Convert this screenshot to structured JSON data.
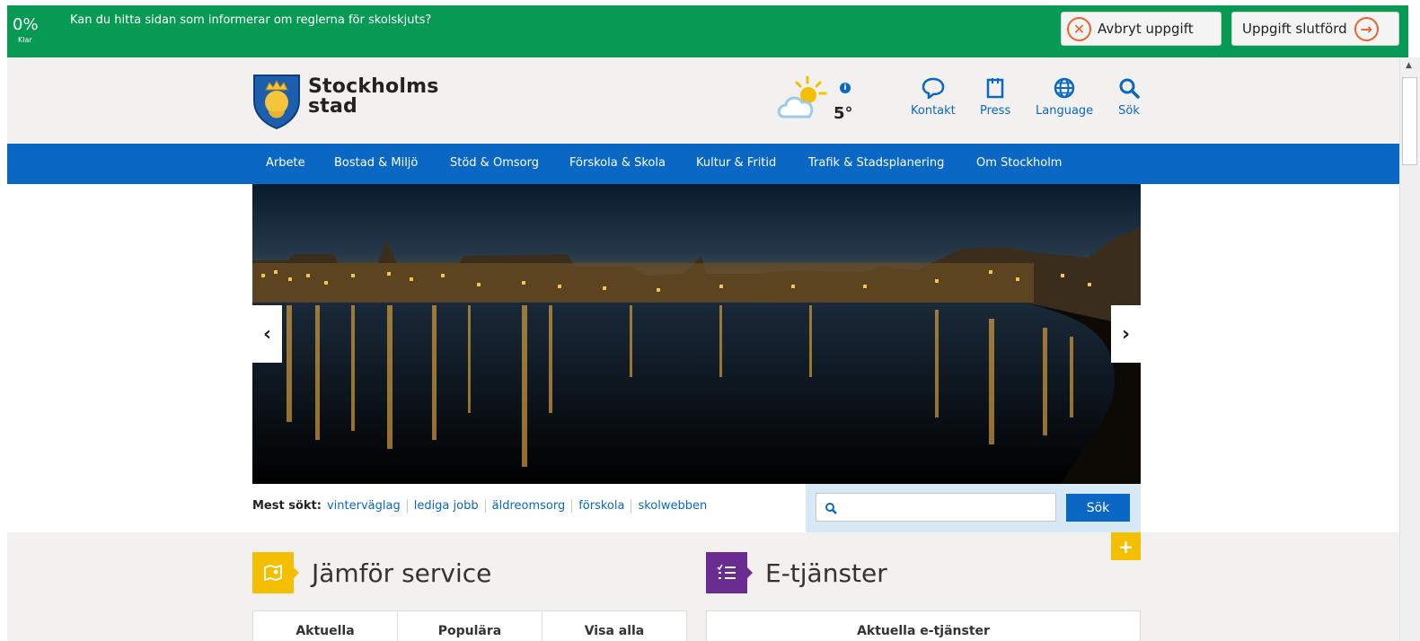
{
  "task": {
    "progress": "0%",
    "progress_label": "Klar",
    "question": "Kan du hitta sidan som informerar om reglerna för skolskjuts?",
    "abort_label": "Avbryt uppgift",
    "done_label": "Uppgift slutförd"
  },
  "header": {
    "logo_line1": "Stockholms",
    "logo_line2": "stad",
    "temperature": "5°",
    "links": [
      {
        "label": "Kontakt",
        "icon": "speech-bubble-icon"
      },
      {
        "label": "Press",
        "icon": "notepad-icon"
      },
      {
        "label": "Language",
        "icon": "globe-icon"
      },
      {
        "label": "Sök",
        "icon": "search-icon"
      }
    ]
  },
  "nav": {
    "items": [
      "Arbete",
      "Bostad & Miljö",
      "Stöd & Omsorg",
      "Förskola & Skola",
      "Kultur & Fritid",
      "Trafik & Stadsplanering",
      "Om Stockholm"
    ]
  },
  "popular": {
    "label": "Mest sökt:",
    "items": [
      "vinterväglag",
      "lediga jobb",
      "äldreomsorg",
      "förskola",
      "skolwebben"
    ]
  },
  "search": {
    "button": "Sök",
    "placeholder": ""
  },
  "sections": {
    "compare_title": "Jämför service",
    "compare_tabs": [
      "Aktuella",
      "Populära",
      "Visa alla"
    ],
    "eservices_title": "E-tjänster",
    "eservices_tab": "Aktuella e-tjänster"
  },
  "colors": {
    "taskbar": "#079a55",
    "brand_blue": "#0a68c4",
    "accent_yellow": "#f4bf00",
    "accent_purple": "#6b2c91"
  }
}
